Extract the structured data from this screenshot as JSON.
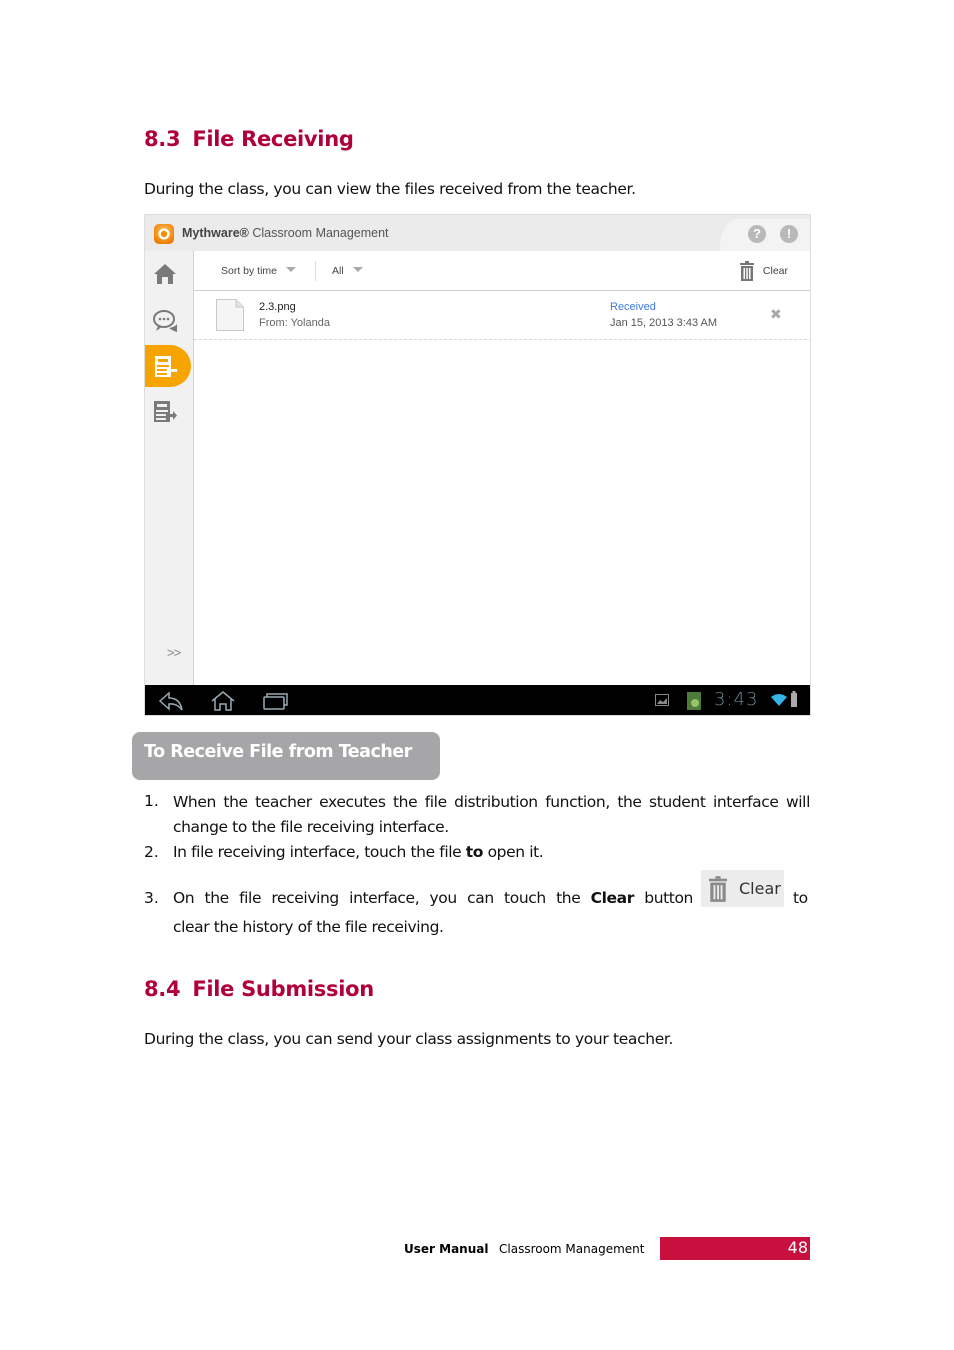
{
  "section_83": {
    "number": "8.3",
    "title": "File Receiving",
    "intro": "During the class, you can view the files received from the teacher."
  },
  "app": {
    "brand": "Mythware®",
    "product": "Classroom Management",
    "help_icon": "question-circle-icon",
    "info_icon": "exclamation-circle-icon",
    "sidebar": [
      {
        "name": "home",
        "icon": "home-icon",
        "active": false
      },
      {
        "name": "chat",
        "icon": "chat-bubbles-icon",
        "active": false
      },
      {
        "name": "file-receiving",
        "icon": "file-receive-icon",
        "active": true
      },
      {
        "name": "file-submission",
        "icon": "file-submit-icon",
        "active": false
      }
    ],
    "expand_label": ">>",
    "toolbar": {
      "sort_label": "Sort by time",
      "filter_label": "All",
      "clear_label": "Clear"
    },
    "files": [
      {
        "name": "2.3.png",
        "from": "From: Yolanda",
        "status": "Received",
        "date": "Jan 15, 2013 3:43 AM"
      }
    ],
    "statusbar": {
      "time": "3:43"
    }
  },
  "callout": {
    "label": "To Receive File from Teacher"
  },
  "steps": [
    {
      "num": "1.",
      "text": "When the teacher executes the file distribution function, the student interface will change to the file receiving interface."
    },
    {
      "num": "2.",
      "text_before": "In file receiving interface, touch the file ",
      "bold": "to",
      "text_after": " open it."
    },
    {
      "num": "3.",
      "text_before": "On the file receiving interface, you can touch the ",
      "bold": "Clear",
      "text_middle": " button",
      "button_label": "Clear",
      "text_after": "to",
      "text_line2": "clear the history of the file receiving."
    }
  ],
  "section_84": {
    "number": "8.4",
    "title": "File Submission",
    "intro": "During the class, you can send your class assignments to your teacher."
  },
  "footer": {
    "doc_type": "User  Manual",
    "product": "Classroom  Management",
    "page": "48"
  }
}
